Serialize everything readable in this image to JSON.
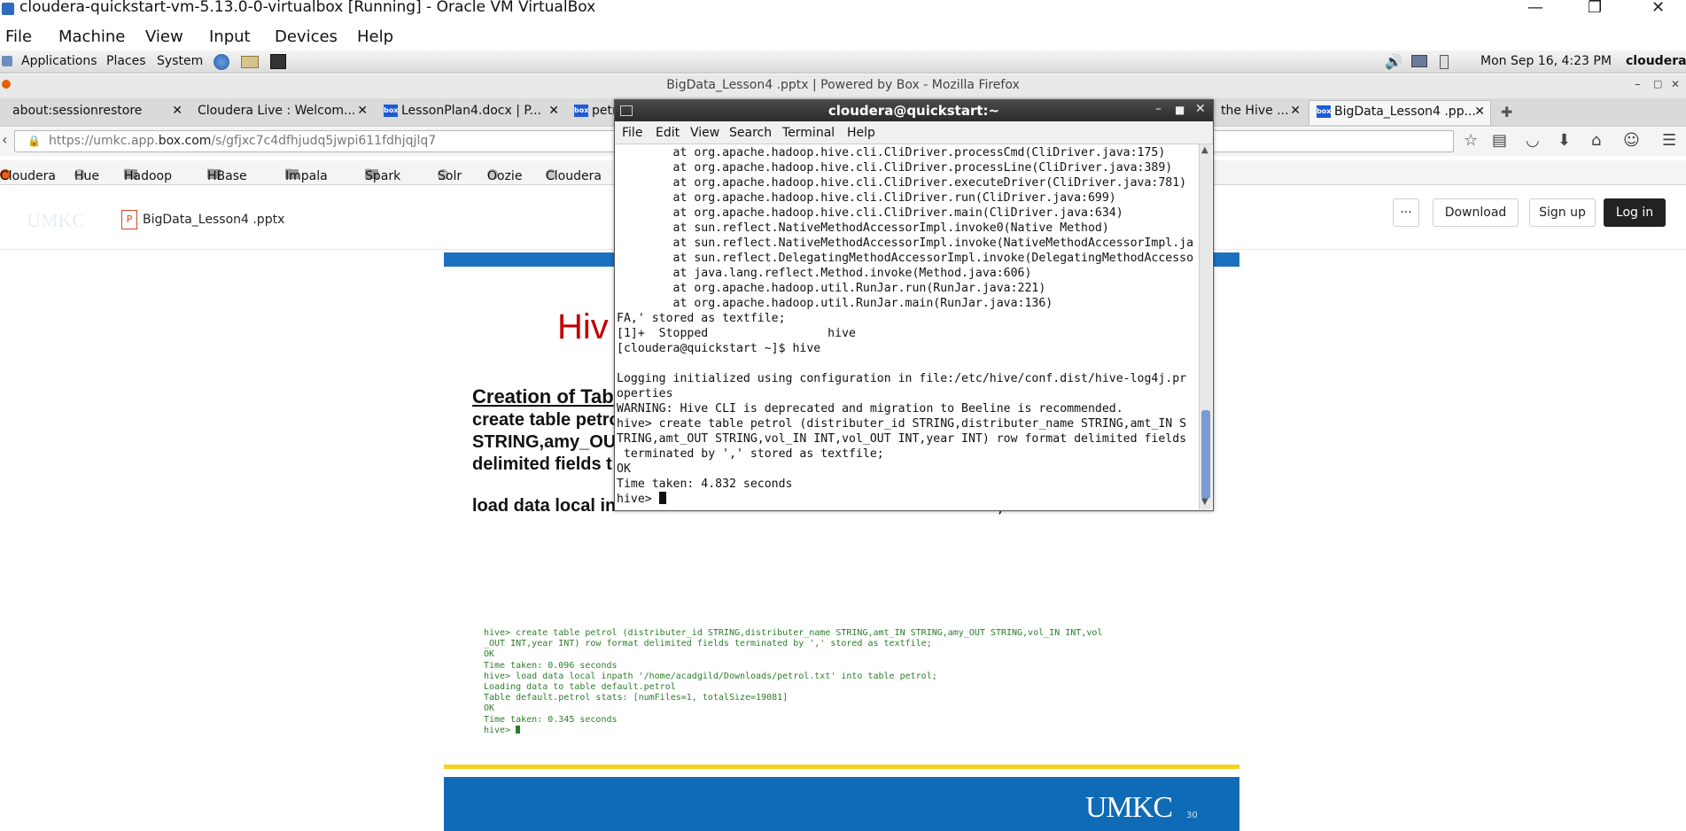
{
  "vbox": {
    "title": "cloudera-quickstart-vm-5.13.0-0-virtualbox [Running] - Oracle VM VirtualBox",
    "menu": [
      "File",
      "Machine",
      "View",
      "Input",
      "Devices",
      "Help"
    ],
    "controls": {
      "minimize": "—",
      "maximize": "❐",
      "close": "✕"
    }
  },
  "gnome": {
    "menu": [
      "Applications",
      "Places",
      "System"
    ],
    "datetime": "Mon Sep 16,  4:23 PM",
    "user": "cloudera"
  },
  "firefox": {
    "title": "BigData_Lesson4 .pptx | Powered by Box - Mozilla Firefox",
    "tabs": [
      {
        "label": "about:sessionrestore"
      },
      {
        "label": "Cloudera Live : Welcom..."
      },
      {
        "label": "LessonPlan4.docx | P..."
      },
      {
        "label": "petr"
      },
      {
        "label": "the Hive ..."
      },
      {
        "label": "BigData_Lesson4 .pp..."
      }
    ],
    "url": "https://umkc.app.box.com/s/gfjxc7c4dfhjudq5jwpi611fdhjqjlq7",
    "url_prefix": "https://umkc.app.",
    "url_domain": "box.com",
    "url_rest": "/s/gfjxc7c4dfhjudq5jwpi611fdhjqjlq7",
    "bookmarks": [
      "Cloudera",
      "Hue",
      "Hadoop",
      "HBase",
      "Impala",
      "Spark",
      "Solr",
      "Oozie",
      "Cloudera"
    ]
  },
  "box": {
    "logo": "UMKC",
    "filename": "BigData_Lesson4 .pptx",
    "more": "···",
    "download": "Download",
    "signup": "Sign up",
    "login": "Log in"
  },
  "slide": {
    "title": "Hiv",
    "subtitle": "Creation of Tab",
    "lines": [
      "create table petro",
      "STRING,amy_OUT",
      "delimited fields t",
      "load data local in"
    ],
    "tail": "                                                                              ',",
    "terminal_lines": [
      "hive> create table petrol (distributer_id STRING,distributer_name STRING,amt_IN STRING,amy_OUT STRING,vol_IN INT,vol",
      "_OUT INT,year INT) row format delimited fields terminated by ',' stored as textfile;",
      "OK",
      "Time taken: 0.096 seconds",
      "hive> load data local inpath '/home/acadgild/Downloads/petrol.txt' into table petrol;",
      "Loading data to table default.petrol",
      "Table default.petrol stats: [numFiles=1, totalSize=19081]",
      "OK",
      "Time taken: 0.345 seconds",
      "hive> "
    ],
    "footer_logo": "UMKC",
    "page": "30"
  },
  "terminal": {
    "title": "cloudera@quickstart:~",
    "menu": [
      "File",
      "Edit",
      "View",
      "Search",
      "Terminal",
      "Help"
    ],
    "lines": [
      "        at org.apache.hadoop.hive.cli.CliDriver.processCmd(CliDriver.java:175)",
      "        at org.apache.hadoop.hive.cli.CliDriver.processLine(CliDriver.java:389)",
      "        at org.apache.hadoop.hive.cli.CliDriver.executeDriver(CliDriver.java:781)",
      "        at org.apache.hadoop.hive.cli.CliDriver.run(CliDriver.java:699)",
      "        at org.apache.hadoop.hive.cli.CliDriver.main(CliDriver.java:634)",
      "        at sun.reflect.NativeMethodAccessorImpl.invoke0(Native Method)",
      "        at sun.reflect.NativeMethodAccessorImpl.invoke(NativeMethodAccessorImpl.ja",
      "        at sun.reflect.DelegatingMethodAccessorImpl.invoke(DelegatingMethodAccesso",
      "        at java.lang.reflect.Method.invoke(Method.java:606)",
      "        at org.apache.hadoop.util.RunJar.run(RunJar.java:221)",
      "        at org.apache.hadoop.util.RunJar.main(RunJar.java:136)",
      "FA,' stored as textfile;",
      "[1]+  Stopped                 hive",
      "[cloudera@quickstart ~]$ hive",
      "",
      "Logging initialized using configuration in file:/etc/hive/conf.dist/hive-log4j.pr",
      "operties",
      "WARNING: Hive CLI is deprecated and migration to Beeline is recommended.",
      "hive> create table petrol (distributer_id STRING,distributer_name STRING,amt_IN S",
      "TRING,amt_OUT STRING,vol_IN INT,vol_OUT INT,year INT) row format delimited fields",
      " terminated by ',' stored as textfile;",
      "OK",
      "Time taken: 4.832 seconds",
      "hive> "
    ]
  }
}
